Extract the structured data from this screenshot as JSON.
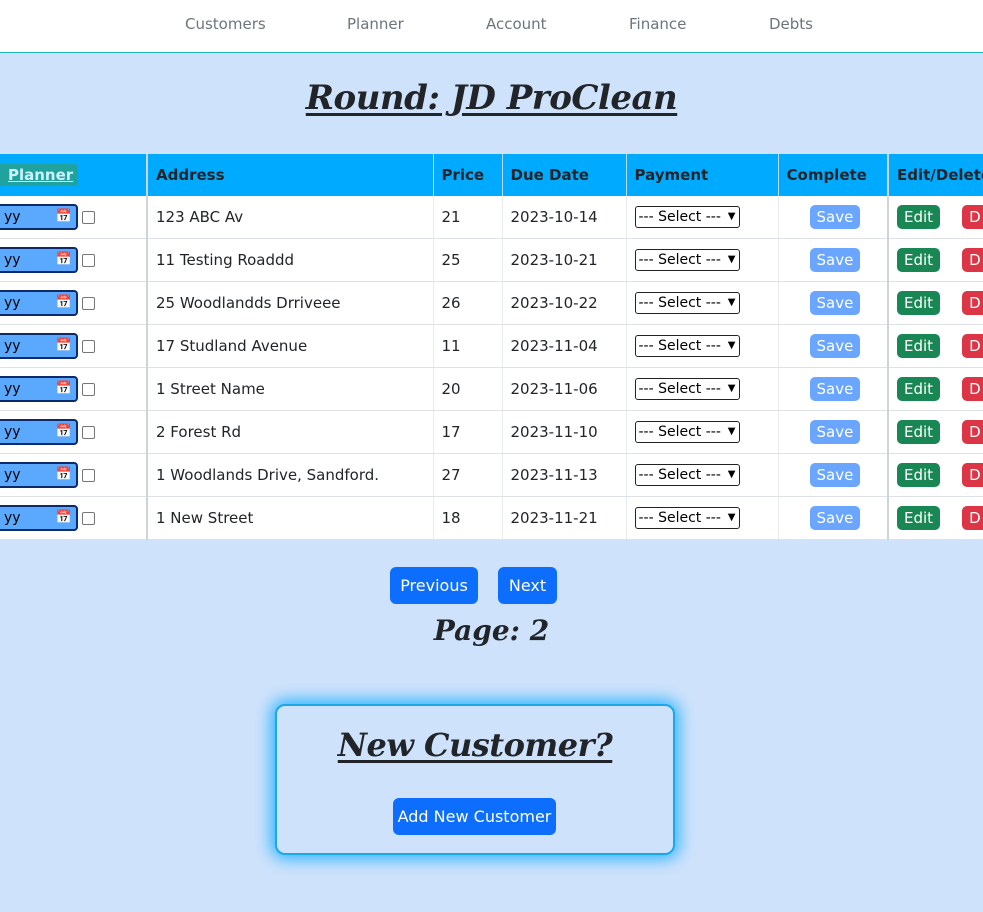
{
  "nav": {
    "items": [
      "Customers",
      "Planner",
      "Account",
      "Finance",
      "Debts"
    ]
  },
  "title": "Round: JD ProClean",
  "table": {
    "headers": {
      "planner": "Planner",
      "address": "Address",
      "price": "Price",
      "due_date": "Due Date",
      "payment": "Payment",
      "complete": "Complete",
      "edit_delete": "Edit/Delete"
    },
    "date_placeholder": "yy",
    "select_default": "--- Select ---",
    "save_label": "Save",
    "edit_label": "Edit",
    "delete_label": "D",
    "rows": [
      {
        "address": "123 ABC Av",
        "price": "21",
        "due_date": "2023-10-14"
      },
      {
        "address": "11 Testing Roaddd",
        "price": "25",
        "due_date": "2023-10-21"
      },
      {
        "address": "25 Woodlandds Drriveee",
        "price": "26",
        "due_date": "2023-10-22"
      },
      {
        "address": "17 Studland Avenue",
        "price": "11",
        "due_date": "2023-11-04"
      },
      {
        "address": "1 Street Name",
        "price": "20",
        "due_date": "2023-11-06"
      },
      {
        "address": "2 Forest Rd",
        "price": "17",
        "due_date": "2023-11-10"
      },
      {
        "address": "1 Woodlands Drive, Sandford.",
        "price": "27",
        "due_date": "2023-11-13"
      },
      {
        "address": "1 New Street",
        "price": "18",
        "due_date": "2023-11-21"
      }
    ]
  },
  "pagination": {
    "previous_label": "Previous",
    "next_label": "Next",
    "page_label": "Page: 2"
  },
  "new_customer": {
    "title": "New Customer?",
    "button_label": "Add New Customer"
  },
  "colors": {
    "background": "#cfe2fb",
    "header": "#00aaff",
    "primary": "#0d6efd",
    "save": "#6aa6ff",
    "edit": "#198754",
    "delete": "#dc3545"
  }
}
